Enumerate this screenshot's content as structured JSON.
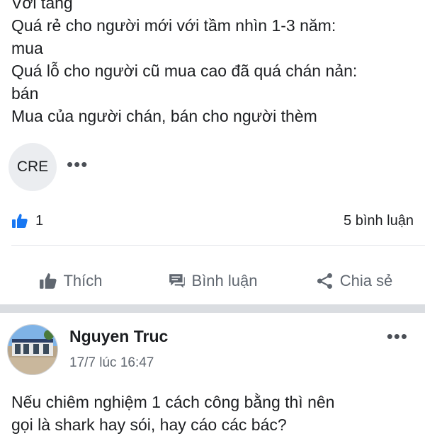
{
  "post1": {
    "lines": [
      "Với tầng",
      "Quá rẻ cho người mới với tầm nhìn 1-3 năm:",
      "mua",
      "Quá lỗ cho người cũ mua cao đã quá chán nản:",
      "bán",
      "Mua của người chán, bán cho người thèm"
    ],
    "tag_label": "CRE",
    "more_label": "•••",
    "like_count": "1",
    "comment_count": "5 bình luận",
    "actions": {
      "like": "Thích",
      "comment": "Bình luận",
      "share": "Chia sẻ"
    }
  },
  "post2": {
    "author": "Nguyen Truc",
    "time": "17/7 lúc 16:47",
    "more_label": "•••",
    "lines": [
      "Nếu chiêm nghiệm 1 cách công bằng thì nên",
      "gọi là shark hay sói, hay cáo các bác?"
    ]
  },
  "colors": {
    "like_blue": "#1877f2",
    "text": "#1c1e21",
    "secondary": "#606770",
    "separator": "#dadde1"
  },
  "icons": [
    "like-badge-icon",
    "thumbs-up-icon",
    "comment-icon",
    "share-icon",
    "more-icon",
    "avatar"
  ]
}
